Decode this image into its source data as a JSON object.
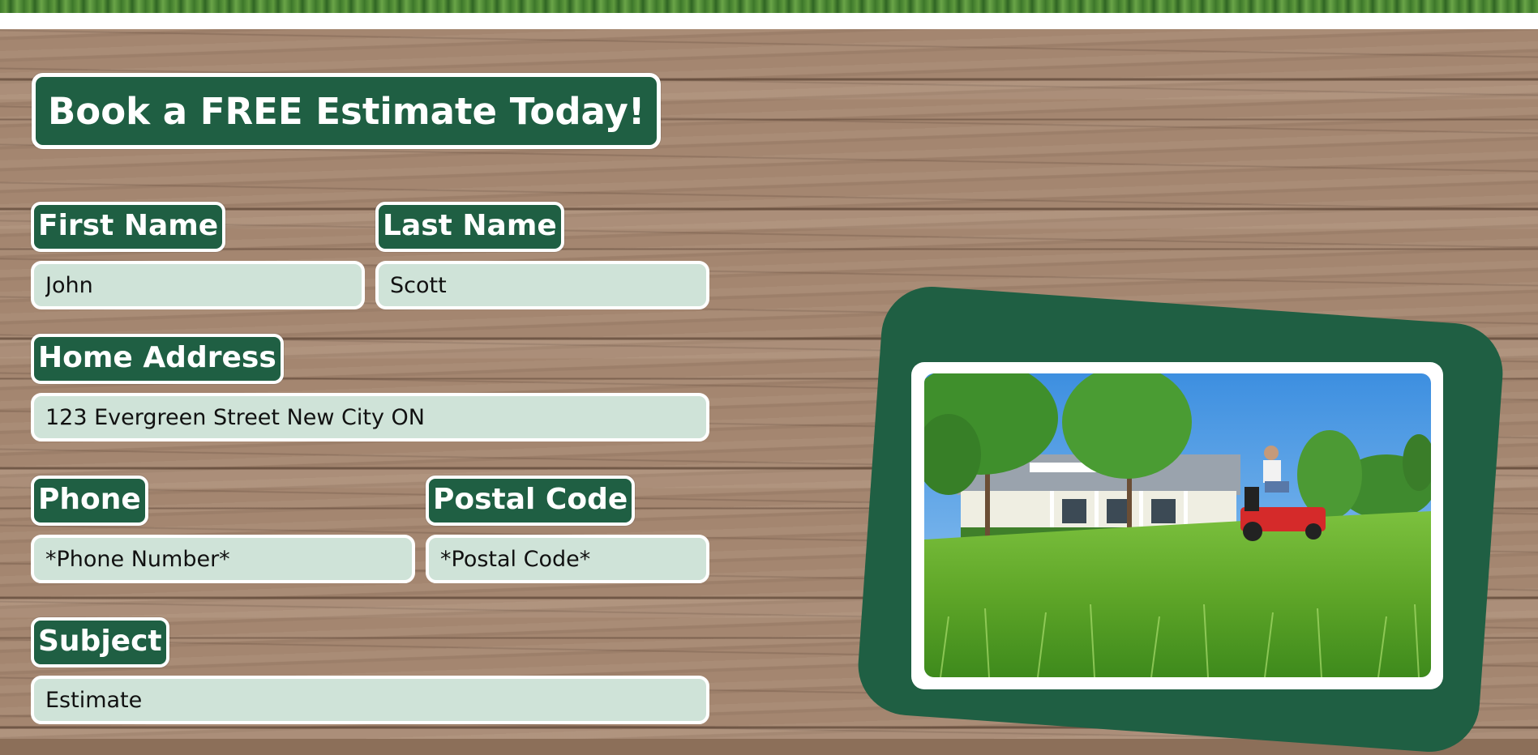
{
  "title": "Book a FREE Estimate Today!",
  "form": {
    "first_name": {
      "label": "First Name",
      "value": "John"
    },
    "last_name": {
      "label": "Last Name",
      "value": "Scott"
    },
    "home_address": {
      "label": "Home Address",
      "value": "123 Evergreen Street New City ON"
    },
    "phone": {
      "label": "Phone",
      "placeholder": "*Phone Number*"
    },
    "postal_code": {
      "label": "Postal Code",
      "placeholder": "*Postal Code*"
    },
    "subject": {
      "label": "Subject",
      "value": "Estimate"
    }
  },
  "colors": {
    "brand_green": "#1f5f43",
    "field_fill": "#cfe3d8",
    "border": "#ffffff"
  },
  "photo": {
    "subject": "lawn-mower-photo"
  }
}
